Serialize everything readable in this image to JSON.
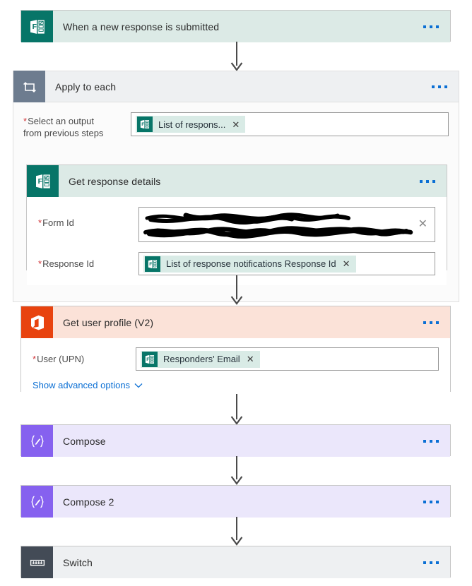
{
  "flow": {
    "nodes": [
      {
        "id": "trigger",
        "title": "When a new response is submitted",
        "icon": "microsoft-forms-icon",
        "menu": "more-commands"
      },
      {
        "id": "apply-to-each",
        "title": "Apply to each",
        "icon": "loop-repeat-icon",
        "field_label": "Select an output from previous steps",
        "field_label_line1": "Select an output",
        "field_label_line2": "from previous steps",
        "required": true,
        "token": {
          "text": "List of respons...",
          "icon": "microsoft-forms-icon",
          "remove": "✕"
        }
      },
      {
        "id": "get-response-details",
        "title": "Get response details",
        "icon": "microsoft-forms-icon",
        "fields": [
          {
            "label": "Form Id",
            "required": true,
            "value": "",
            "redacted": true
          },
          {
            "label": "Response Id",
            "required": true,
            "token": {
              "text": "List of response notifications Response Id",
              "icon": "microsoft-forms-icon",
              "remove": "✕"
            }
          }
        ]
      },
      {
        "id": "get-user-profile",
        "title": "Get user profile (V2)",
        "icon": "office-365-icon",
        "fields": [
          {
            "label": "User (UPN)",
            "required": true,
            "token": {
              "text": "Responders' Email",
              "icon": "microsoft-forms-icon",
              "remove": "✕"
            }
          }
        ],
        "advanced_link": "Show advanced options"
      },
      {
        "id": "compose",
        "title": "Compose",
        "icon": "compose-braces-icon"
      },
      {
        "id": "compose-2",
        "title": "Compose 2",
        "icon": "compose-braces-icon"
      },
      {
        "id": "switch",
        "title": "Switch",
        "icon": "switch-icon"
      }
    ],
    "colors": {
      "forms_tile": "#077568",
      "forms_header": "#dceae6",
      "office_tile": "#e8430f",
      "office_header": "#fbe2d8",
      "compose_tile": "#8661ef",
      "compose_header": "#ebe7fb",
      "switch_tile": "#434b56",
      "loop_tile": "#6d7c8f",
      "plain_header": "#eef0f2",
      "link": "#0b6fd4",
      "required": "#d13438",
      "arrow": "#4a4a4a"
    },
    "required_marker": "*"
  }
}
